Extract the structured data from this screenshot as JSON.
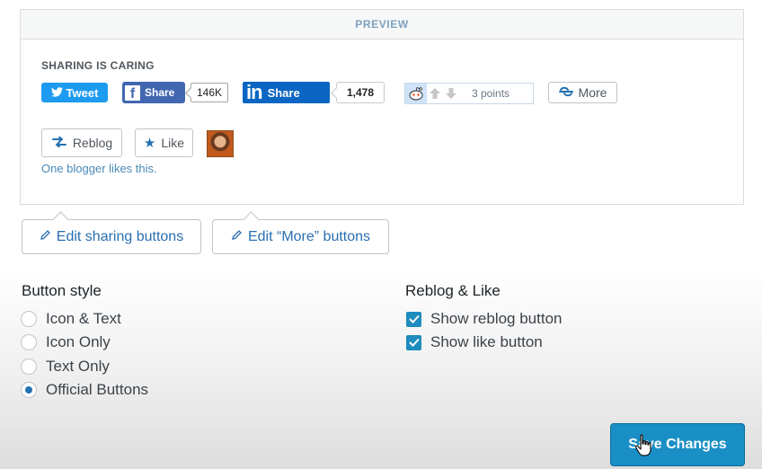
{
  "preview": {
    "header": "PREVIEW",
    "heading": "SHARING IS CARING",
    "twitter": {
      "label": "Tweet",
      "icon": "twitter-bird-icon",
      "color": "#1d9bf0"
    },
    "facebook": {
      "label": "Share",
      "count": "146K",
      "icon": "facebook-icon",
      "color": "#4267b2"
    },
    "linkedin": {
      "label": "Share",
      "count": "1,478",
      "logo": "in",
      "color": "#0a66c2"
    },
    "reddit": {
      "points": "3 points",
      "icon": "reddit-alien-icon"
    },
    "more": {
      "label": "More",
      "icon": "more-share-icon"
    },
    "reblog": {
      "label": "Reblog",
      "icon": "reblog-icon"
    },
    "like": {
      "label": "Like",
      "icon": "star-icon"
    },
    "likes_text": "One blogger likes this."
  },
  "edit_buttons": {
    "sharing": "Edit sharing buttons",
    "more": "Edit “More” buttons"
  },
  "button_style": {
    "title": "Button style",
    "options": [
      {
        "label": "Icon & Text",
        "selected": false
      },
      {
        "label": "Icon Only",
        "selected": false
      },
      {
        "label": "Text Only",
        "selected": false
      },
      {
        "label": "Official Buttons",
        "selected": true
      }
    ]
  },
  "reblog_like": {
    "title": "Reblog & Like",
    "options": [
      {
        "label": "Show reblog button",
        "checked": true
      },
      {
        "label": "Show like button",
        "checked": true
      }
    ]
  },
  "save": {
    "label": "Save Changes",
    "color": "#1a8fc5"
  }
}
